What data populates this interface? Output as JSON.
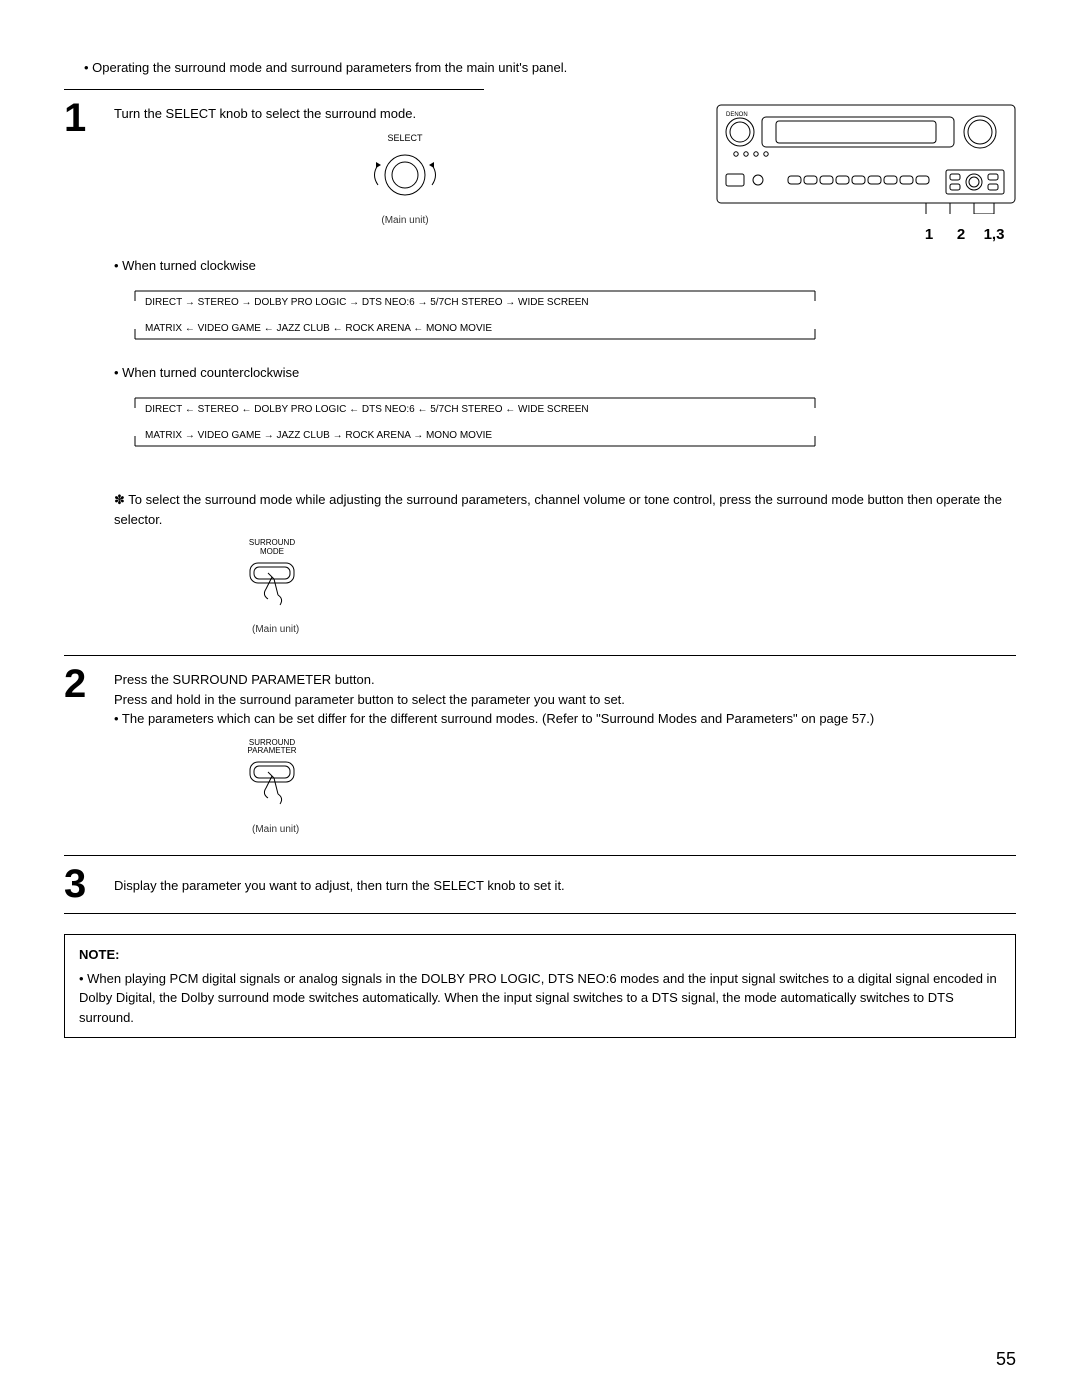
{
  "intro_bullet": "• Operating the surround mode and surround parameters from the main unit's panel.",
  "step1": {
    "num": "1",
    "instruction": "Turn the SELECT knob to select the surround mode.",
    "knob_label": "SELECT",
    "caption": "(Main unit)",
    "cw_heading": "• When turned clockwise",
    "ccw_heading": "• When turned counterclockwise",
    "flow_cw_top": "DIRECT → STEREO → DOLBY PRO LOGIC → DTS NEO:6 → 5/7CH STEREO → WIDE SCREEN",
    "flow_cw_bot": "MATRIX ← VIDEO GAME ← JAZZ CLUB ← ROCK ARENA ← MONO MOVIE",
    "flow_ccw_top": "DIRECT ← STEREO ← DOLBY PRO LOGIC ← DTS NEO:6 ← 5/7CH STEREO ← WIDE SCREEN",
    "flow_ccw_bot": "MATRIX → VIDEO GAME → JAZZ CLUB → ROCK ARENA → MONO MOVIE",
    "star_note": "✽ To select the surround mode while adjusting the surround parameters, channel volume or tone control, press the surround mode button then operate the selector.",
    "mode_btn_label": "SURROUND\nMODE",
    "mode_caption": "(Main unit)",
    "panel_nums": {
      "a": "1",
      "b": "2",
      "c": "1,3"
    }
  },
  "step2": {
    "num": "2",
    "line1": "Press the SURROUND PARAMETER button.",
    "line2": "Press and hold in the surround parameter button to select the parameter you want to set.",
    "line3": "• The parameters which can be set differ for the different surround modes. (Refer to \"Surround Modes and Parameters\" on page 57.)",
    "btn_label": "SURROUND\nPARAMETER",
    "caption": "(Main unit)"
  },
  "step3": {
    "num": "3",
    "text": "Display the parameter you want to adjust, then turn the SELECT knob to set it."
  },
  "note": {
    "title": "NOTE:",
    "body": "• When playing PCM digital signals or analog signals in the DOLBY PRO LOGIC, DTS NEO:6 modes and the input signal switches to a digital signal encoded in Dolby Digital, the Dolby surround mode switches automatically. When the input signal switches to a DTS signal, the mode automatically switches to DTS surround."
  },
  "page_number": "55",
  "brand": "DENON"
}
